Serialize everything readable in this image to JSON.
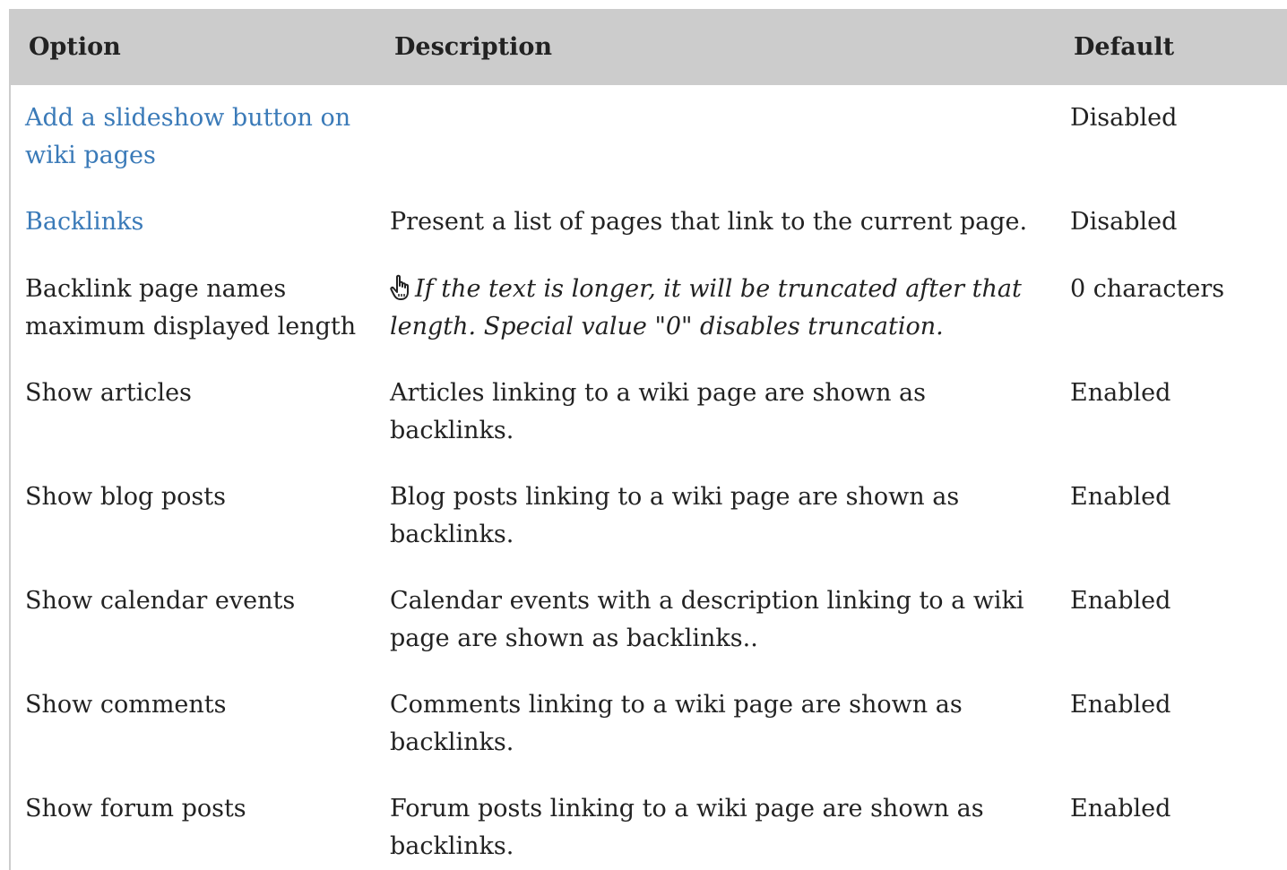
{
  "table": {
    "headers": {
      "option": "Option",
      "description": "Description",
      "default": "Default"
    },
    "rows": [
      {
        "option": "Add a slideshow button on wiki pages",
        "description": "",
        "default": "Disabled",
        "option_is_link": true
      },
      {
        "option": "Backlinks",
        "description": "Present a list of pages that link to the current page.",
        "default": "Disabled",
        "option_is_link": true
      },
      {
        "option": "Backlink page names maximum displayed length",
        "description": "If the text is longer, it will be truncated after that length. Special value \"0\" disables truncation.",
        "default": "0 characters",
        "description_icon": "pointing-hand-icon"
      },
      {
        "option": "Show articles",
        "description": "Articles linking to a wiki page are shown as backlinks.",
        "default": "Enabled"
      },
      {
        "option": "Show blog posts",
        "description": "Blog posts linking to a wiki page are shown as backlinks.",
        "default": "Enabled"
      },
      {
        "option": "Show calendar events",
        "description": "Calendar events with a description linking to a wiki page are shown as backlinks..",
        "default": "Enabled"
      },
      {
        "option": "Show comments",
        "description": "Comments linking to a wiki page are shown as backlinks.",
        "default": "Enabled"
      },
      {
        "option": "Show forum posts",
        "description": "Forum posts linking to a wiki page are shown as backlinks.",
        "default": "Enabled"
      }
    ]
  },
  "colors": {
    "header_bg": "#cccccc",
    "link": "#3a7ab8",
    "text": "#222222"
  }
}
